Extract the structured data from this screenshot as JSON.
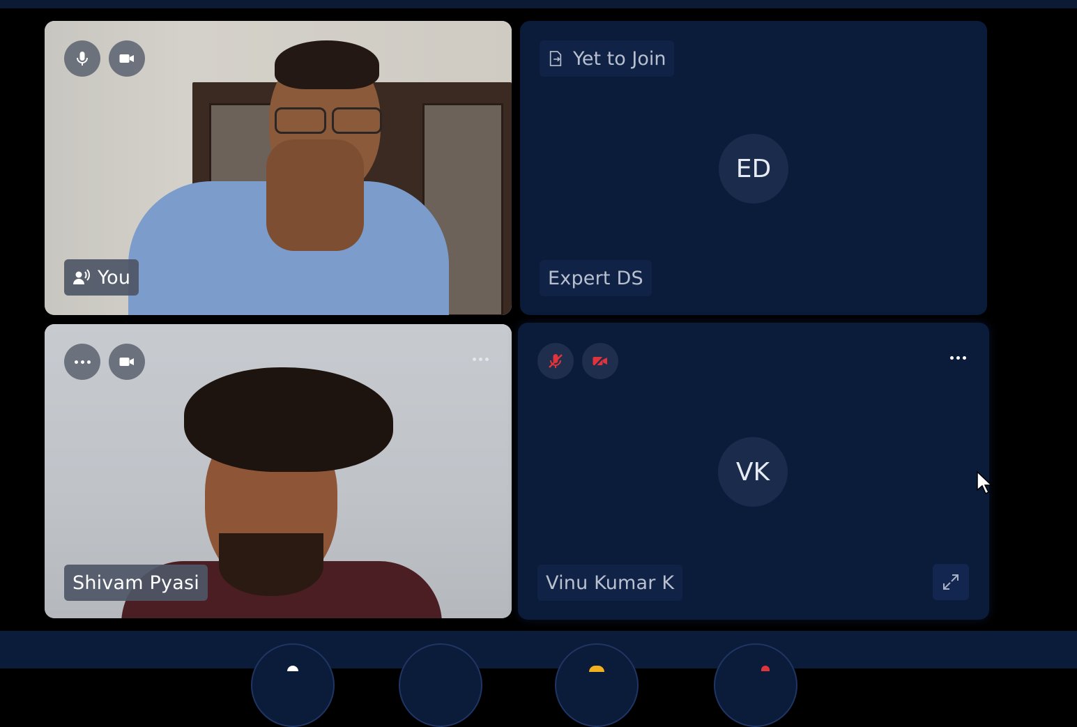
{
  "participants": [
    {
      "id": "you",
      "name": "You",
      "status": "video-on",
      "mic": "on",
      "camera": "on"
    },
    {
      "id": "expert",
      "name": "Expert DS",
      "initials": "ED",
      "status_label": "Yet to Join"
    },
    {
      "id": "shivam",
      "name": "Shivam Pyasi",
      "status": "video-on"
    },
    {
      "id": "vinu",
      "name": "Vinu Kumar K",
      "initials": "VK",
      "mic": "muted",
      "camera": "off"
    }
  ],
  "icons": {
    "mic": "microphone-icon",
    "camera": "video-camera-icon",
    "mic_muted": "microphone-off-icon",
    "camera_off": "video-camera-off-icon",
    "speaking": "speaking-person-icon",
    "join": "join-exit-icon",
    "more": "more-horizontal-icon",
    "expand": "expand-icon"
  },
  "colors": {
    "muted_red": "#e0343d",
    "tile_navy": "#0b1b3a",
    "chip_grey": "#646a76"
  }
}
